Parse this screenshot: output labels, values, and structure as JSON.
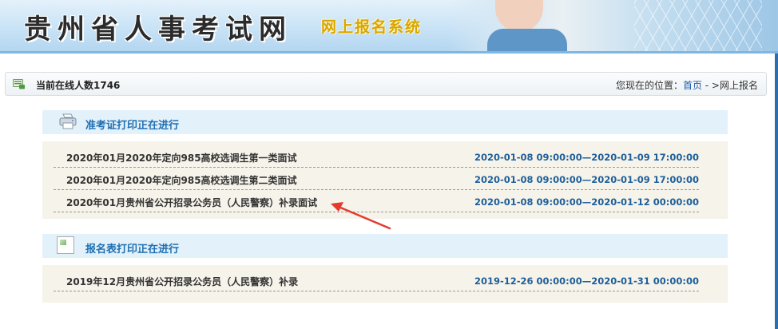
{
  "banner": {
    "title": "贵州省人事考试网",
    "subtitle": "网上报名系统"
  },
  "status": {
    "online_label": "当前在线人数1746",
    "location_prefix": "您现在的位置：",
    "home_link": "首页",
    "separator": " - >",
    "current_page": "网上报名"
  },
  "sections": [
    {
      "title": "准考证打印正在进行",
      "icon": "printer-icon",
      "items": [
        {
          "name": "2020年01月2020年定向985高校选调生第一类面试",
          "time": "2020-01-08 09:00:00—2020-01-09 17:00:00"
        },
        {
          "name": "2020年01月2020年定向985高校选调生第二类面试",
          "time": "2020-01-08 09:00:00—2020-01-09 17:00:00"
        },
        {
          "name": "2020年01月贵州省公开招录公务员（人民警察）补录面试",
          "time": "2020-01-08 09:00:00—2020-01-12 00:00:00"
        }
      ]
    },
    {
      "title": "报名表打印正在进行",
      "icon": "broken-image-icon",
      "items": [
        {
          "name": "2019年12月贵州省公开招录公务员（人民警察）补录",
          "time": "2019-12-26 00:00:00—2020-01-31 00:00:00"
        }
      ]
    }
  ],
  "colors": {
    "accent": "#1e6fb2",
    "time_text": "#1e5f9a",
    "annotation_arrow": "#e53a2f",
    "section_head_bg": "#e3f1fa",
    "section_body_bg": "#f6f3ea"
  }
}
